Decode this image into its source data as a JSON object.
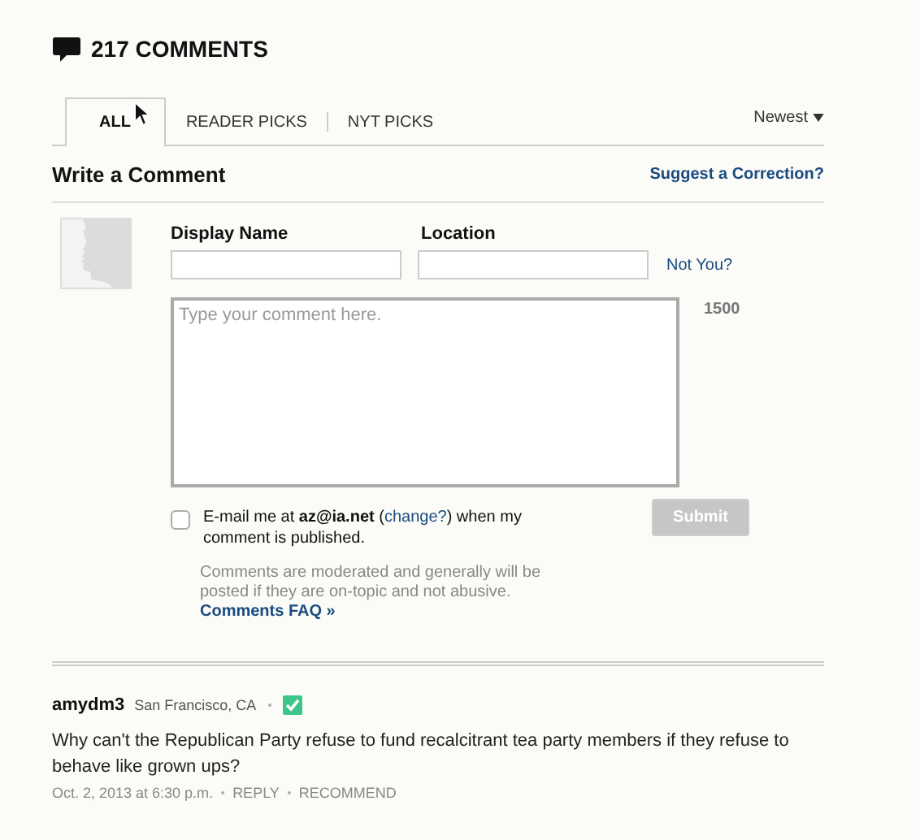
{
  "header": {
    "title": "217 COMMENTS"
  },
  "tabs": [
    {
      "label": "ALL",
      "selected": true
    },
    {
      "label": "READER PICKS",
      "selected": false
    },
    {
      "label": "NYT PICKS",
      "selected": false
    }
  ],
  "sort": {
    "label": "Newest"
  },
  "form": {
    "title": "Write a Comment",
    "correction_link": "Suggest a Correction?",
    "name_label": "Display Name",
    "location_label": "Location",
    "not_you": "Not You?",
    "placeholder": "Type your comment here.",
    "char_count": "1500",
    "email": {
      "checked": false,
      "before": "E-mail me at **az@ia.net** (",
      "link": "change?",
      "after": ") when my comment is published."
    },
    "submit": {
      "label": "Submit",
      "disabled": true
    },
    "note": "Comments are moderated and generally will be posted if they are on-topic and not abusive.",
    "faq_link": "Comments FAQ »"
  },
  "comments": [
    {
      "user": "amydm3",
      "location": "San Francisco, CA",
      "verified": true,
      "text": "Why can't the Republican Party refuse to fund recalcitrant tea party members if they refuse to behave like grown ups?",
      "date": "Oct. 2, 2013 at 6:30 p.m.",
      "actions": [
        "REPLY",
        "RECOMMEND"
      ]
    }
  ]
}
